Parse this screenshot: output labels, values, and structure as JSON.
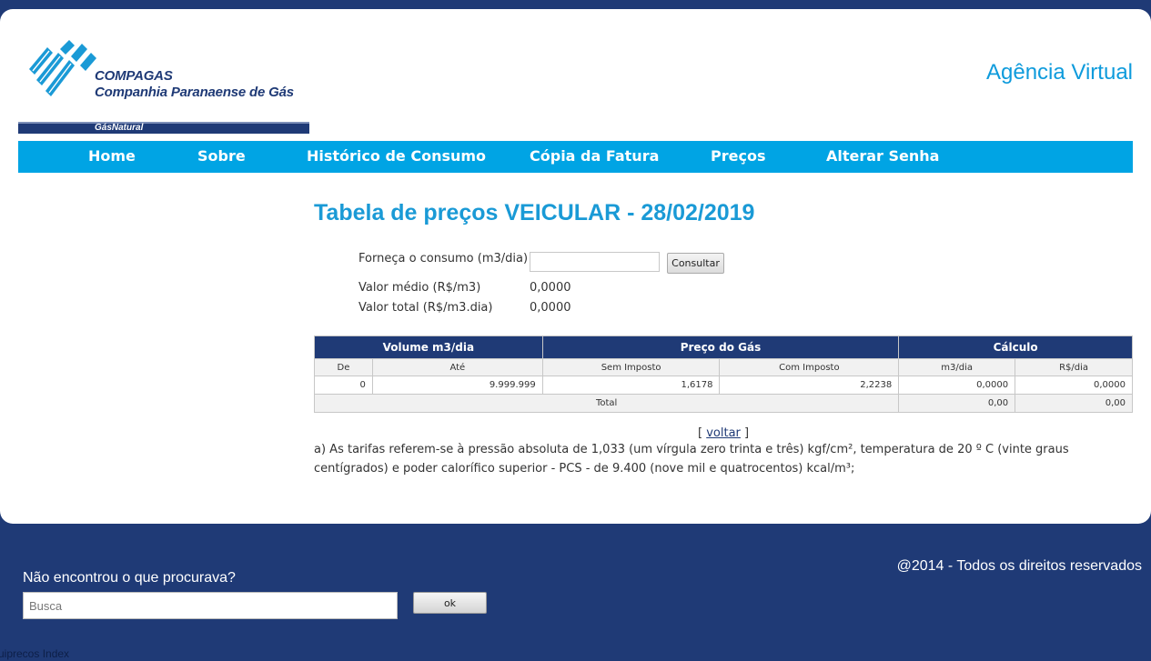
{
  "header": {
    "logo_name": "COMPAGAS",
    "logo_subtitle": "Companhia Paranaense de Gás",
    "logo_tagline": "GásNatural",
    "agency_title": "Agência Virtual"
  },
  "nav": {
    "items": [
      {
        "label": "Home"
      },
      {
        "label": "Sobre"
      },
      {
        "label": "Histórico de Consumo"
      },
      {
        "label": "Cópia da Fatura"
      },
      {
        "label": "Preços"
      },
      {
        "label": "Alterar Senha"
      }
    ]
  },
  "main": {
    "title": "Tabela de preços VEICULAR - 28/02/2019",
    "form": {
      "consumo_label": "Forneça o consumo (m3/dia)",
      "consumo_value": "",
      "consultar_label": "Consultar",
      "valor_medio_label": "Valor médio (R$/m3)",
      "valor_medio": "0,0000",
      "valor_total_label": "Valor total (R$/m3.dia)",
      "valor_total": "0,0000"
    },
    "table": {
      "groups": [
        "Volume m3/dia",
        "Preço do Gás",
        "Cálculo"
      ],
      "columns": [
        "De",
        "Até",
        "Sem Imposto",
        "Com Imposto",
        "m3/dia",
        "R$/dia"
      ],
      "rows": [
        [
          "0",
          "9.999.999",
          "1,6178",
          "2,2238",
          "0,0000",
          "0,0000"
        ]
      ],
      "total_label": "Total",
      "total_m3": "0,00",
      "total_rs": "0,00"
    },
    "back": {
      "open": "[",
      "label": "voltar",
      "close": "]"
    },
    "note": "a) As tarifas referem-se à pressão absoluta de 1,033 (um vírgula zero trinta e três) kgf/cm², temperatura de 20 º C (vinte graus centígrados) e poder calorífico superior - PCS - de 9.400 (nove mil e quatrocentos) kcal/m³;"
  },
  "footer": {
    "copyright": "@2014 - Todos os direitos reservados",
    "search_title": "Não encontrou o que procurava?",
    "search_placeholder": "Busca",
    "ok_label": "ok",
    "trace": "uiprecos Index"
  },
  "colors": {
    "navy": "#1f3a76",
    "cyan": "#00a4e4",
    "title_blue": "#1a9ad6"
  }
}
